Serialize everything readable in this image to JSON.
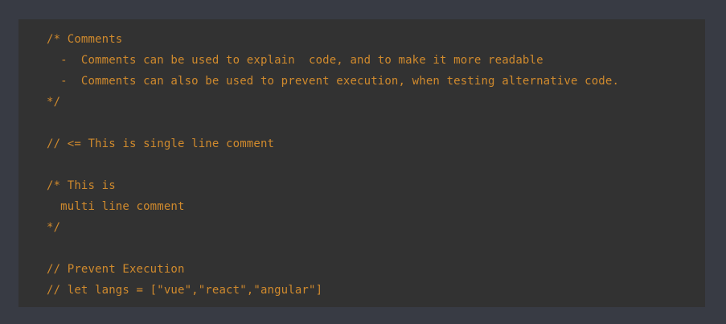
{
  "theme": {
    "page_background": "#383b44",
    "code_background": "#323232",
    "comment_color": "#d08a2d"
  },
  "code": {
    "lines": [
      "/* Comments",
      "  -  Comments can be used to explain  code, and to make it more readable",
      "  -  Comments can also be used to prevent execution, when testing alternative code.",
      "*/",
      "",
      "// <= This is single line comment",
      "",
      "/* This is",
      "  multi line comment",
      "*/",
      "",
      "// Prevent Execution",
      "// let langs = [\"vue\",\"react\",\"angular\"]"
    ]
  }
}
